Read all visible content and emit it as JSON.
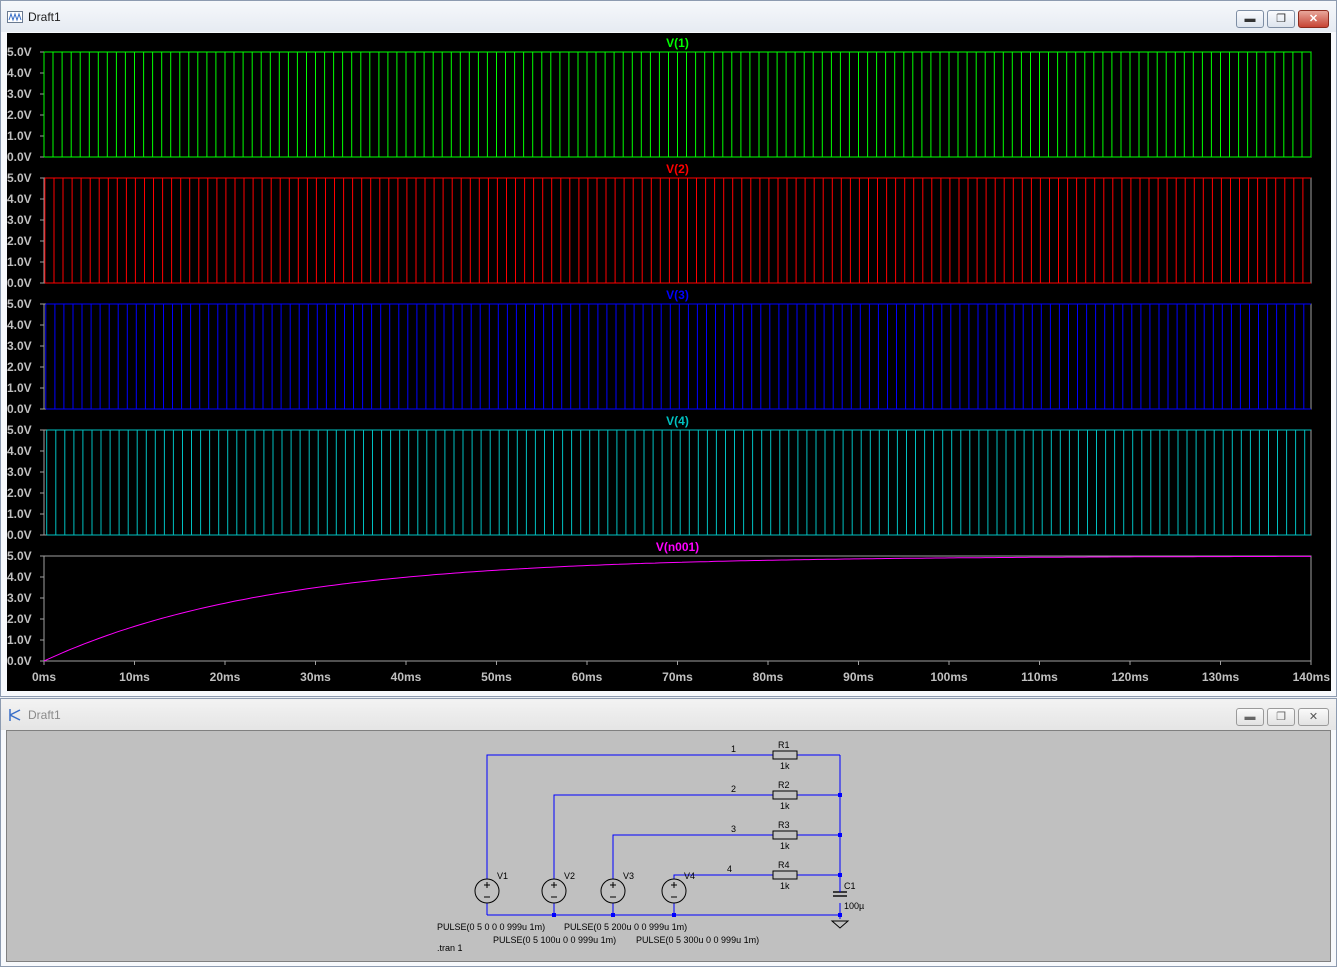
{
  "plot_window": {
    "title": "Draft1",
    "controls": {
      "minimize": "▬",
      "restore": "❐",
      "close": "✕"
    }
  },
  "schematic_window": {
    "title": "Draft1",
    "controls": {
      "minimize": "▬",
      "restore": "❐",
      "close": "✕"
    }
  },
  "colors": {
    "v1": "#00ff00",
    "v2": "#ff0000",
    "v3": "#0000ff",
    "v4": "#00c0c0",
    "vn001": "#ff00ff",
    "wire": "#0000ff",
    "component": "#000000",
    "plot_bg": "#000000",
    "schematic_bg": "#c0c0c0"
  },
  "chart_data": {
    "type": "line",
    "x_ticks": [
      "0ms",
      "10ms",
      "20ms",
      "30ms",
      "40ms",
      "50ms",
      "60ms",
      "70ms",
      "80ms",
      "90ms",
      "100ms",
      "110ms",
      "120ms",
      "130ms",
      "140ms"
    ],
    "xlim": [
      0,
      140
    ],
    "y_ticks": [
      "5.0V",
      "4.0V",
      "3.0V",
      "2.0V",
      "1.0V",
      "0.0V"
    ],
    "panes": [
      {
        "trace": "V(1)",
        "type": "pulse",
        "pulse_period_ms": 1,
        "offset_ms": 0,
        "ylim": [
          0,
          5
        ]
      },
      {
        "trace": "V(2)",
        "type": "pulse",
        "pulse_period_ms": 1,
        "offset_ms": 0.1,
        "ylim": [
          0,
          5
        ]
      },
      {
        "trace": "V(3)",
        "type": "pulse",
        "pulse_period_ms": 1,
        "offset_ms": 0.2,
        "ylim": [
          0,
          5
        ]
      },
      {
        "trace": "V(4)",
        "type": "pulse",
        "pulse_period_ms": 1,
        "offset_ms": 0.3,
        "ylim": [
          0,
          5
        ]
      },
      {
        "trace": "V(n001)",
        "type": "rc_charge",
        "final_v": 5,
        "tau_ms": 25,
        "ylim": [
          0,
          5
        ],
        "points": [
          [
            0,
            0
          ],
          [
            10,
            1.65
          ],
          [
            20,
            2.75
          ],
          [
            30,
            3.5
          ],
          [
            40,
            3.99
          ],
          [
            50,
            4.33
          ],
          [
            60,
            4.55
          ],
          [
            70,
            4.7
          ],
          [
            80,
            4.8
          ],
          [
            90,
            4.87
          ],
          [
            100,
            4.91
          ],
          [
            110,
            4.94
          ],
          [
            120,
            4.96
          ],
          [
            130,
            4.97
          ],
          [
            140,
            4.98
          ]
        ]
      }
    ]
  },
  "schematic": {
    "nets": [
      "1",
      "2",
      "3",
      "4"
    ],
    "resistors": [
      {
        "name": "R1",
        "value": "1k"
      },
      {
        "name": "R2",
        "value": "1k"
      },
      {
        "name": "R3",
        "value": "1k"
      },
      {
        "name": "R4",
        "value": "1k"
      }
    ],
    "sources": [
      "V1",
      "V2",
      "V3",
      "V4"
    ],
    "capacitor": {
      "name": "C1",
      "value": "100µ"
    },
    "directives": [
      "PULSE(0 5 0 0 0 999u 1m)",
      "PULSE(0 5 200u 0 0 999u 1m)",
      "PULSE(0 5 100u 0 0 999u 1m)",
      "PULSE(0 5 300u 0 0 999u 1m)",
      ".tran 1"
    ]
  }
}
